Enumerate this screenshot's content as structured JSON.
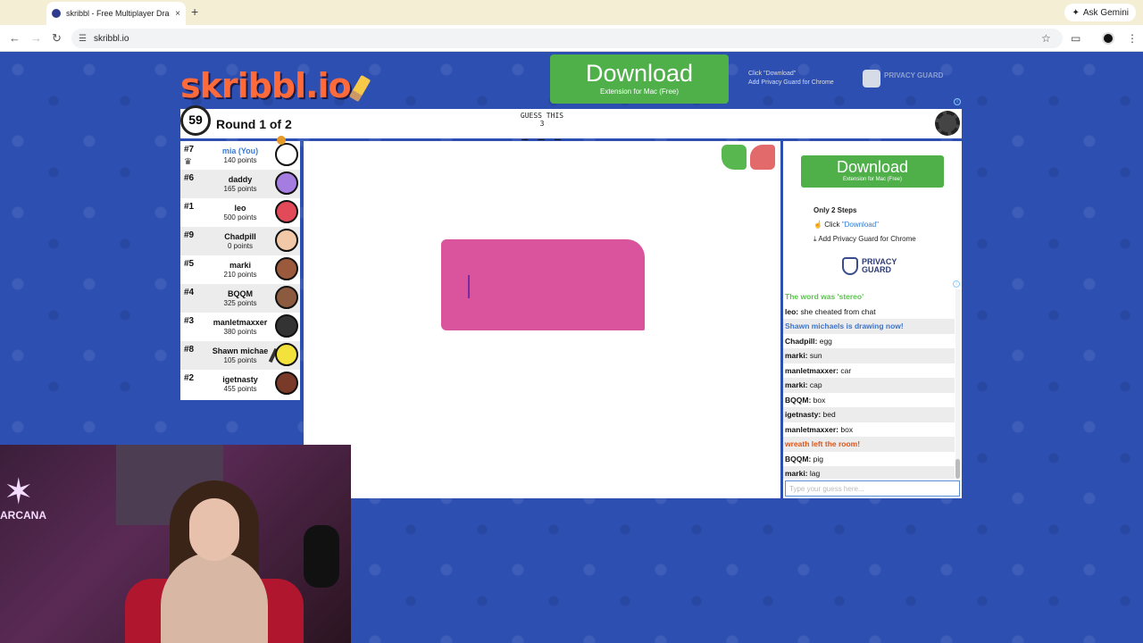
{
  "browser": {
    "tab_title": "skribbl - Free Multiplayer Dra",
    "tab_close": "×",
    "new_tab": "+",
    "ask_gemini": "Ask Gemini",
    "url": "skribbl.io"
  },
  "header": {
    "logo": "skribbl.io",
    "ad_top": {
      "button": "Download",
      "sub": "Extension for Mac (Free)",
      "note_line1": "Click \"Download\"",
      "note_line2": "Add Privacy Guard for Chrome",
      "brand": "PRIVACY GUARD"
    }
  },
  "game": {
    "timer": "59",
    "round": "Round 1 of 2",
    "guess_label": "GUESS THIS",
    "word_length": "3",
    "word_blanks": "_ _ _"
  },
  "players": [
    {
      "rank": "#7",
      "name": "mia (You)",
      "points": "140 points",
      "you": true,
      "avatar_color": "#ffffff"
    },
    {
      "rank": "#6",
      "name": "daddy",
      "points": "165 points",
      "avatar_color": "#a57de0"
    },
    {
      "rank": "#1",
      "name": "leo",
      "points": "500 points",
      "avatar_color": "#e24a5a"
    },
    {
      "rank": "#9",
      "name": "Chadpill",
      "points": "0 points",
      "avatar_color": "#f2c9a8"
    },
    {
      "rank": "#5",
      "name": "marki",
      "points": "210 points",
      "avatar_color": "#9b5a3c"
    },
    {
      "rank": "#4",
      "name": "BQQM",
      "points": "325 points",
      "avatar_color": "#8c5a3e"
    },
    {
      "rank": "#3",
      "name": "manletmaxxer",
      "points": "380 points",
      "avatar_color": "#333333"
    },
    {
      "rank": "#8",
      "name": "Shawn michae",
      "points": "105 points",
      "avatar_color": "#f2e23b"
    },
    {
      "rank": "#2",
      "name": "igetnasty",
      "points": "455 points",
      "avatar_color": "#7a3a2a"
    }
  ],
  "side_ad": {
    "button": "Download",
    "sub": "Extension for Mac (Free)",
    "steps_title": "Only 2 Steps",
    "step1_prefix": "Click ",
    "step1_link": "\"Download\"",
    "step2": "Add Privacy Guard for Chrome",
    "brand_line1": "PRIVACY",
    "brand_line2": "GUARD"
  },
  "chat": [
    {
      "type": "green",
      "text": "The word was 'stereo'"
    },
    {
      "type": "msg",
      "who": "leo:",
      "text": " she cheated from chat"
    },
    {
      "type": "blue",
      "text": "Shawn michaels is drawing now!"
    },
    {
      "type": "msg",
      "who": "Chadpill:",
      "text": " egg"
    },
    {
      "type": "msg",
      "who": "marki:",
      "text": " sun"
    },
    {
      "type": "msg",
      "who": "manletmaxxer:",
      "text": " car"
    },
    {
      "type": "msg",
      "who": "marki:",
      "text": " cap"
    },
    {
      "type": "msg",
      "who": "BQQM:",
      "text": " box"
    },
    {
      "type": "msg",
      "who": "igetnasty:",
      "text": " bed"
    },
    {
      "type": "msg",
      "who": "manletmaxxer:",
      "text": " box"
    },
    {
      "type": "orange",
      "text": "wreath left the room!"
    },
    {
      "type": "msg",
      "who": "BQQM:",
      "text": " pig"
    },
    {
      "type": "msg",
      "who": "marki:",
      "text": " lag"
    }
  ],
  "input": {
    "placeholder": "Type your guess here..."
  },
  "webcam": {
    "neon_text": "ARCANA"
  },
  "colors": {
    "page_bg": "#2d4fb2",
    "download_green": "#4fb04a",
    "drawing_pink": "#d9539d"
  }
}
